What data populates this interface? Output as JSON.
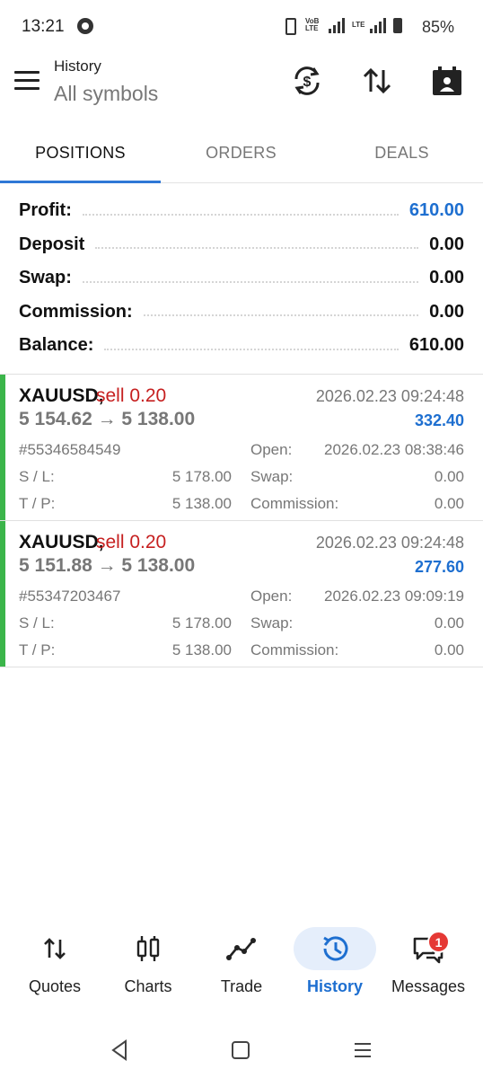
{
  "status_bar": {
    "time": "13:21",
    "battery": "85%",
    "net_label": "VoB LTE",
    "lte_label": "LTE"
  },
  "header": {
    "title": "History",
    "subtitle": "All symbols",
    "icons": [
      "menu-icon",
      "currency-exchange-icon",
      "sort-icon",
      "calendar-icon"
    ]
  },
  "tabs": [
    {
      "label": "POSITIONS",
      "active": true
    },
    {
      "label": "ORDERS",
      "active": false
    },
    {
      "label": "DEALS",
      "active": false
    }
  ],
  "summary": [
    {
      "label": "Profit:",
      "value": "610.00",
      "highlight": true
    },
    {
      "label": "Deposit",
      "value": "0.00",
      "highlight": false
    },
    {
      "label": "Swap:",
      "value": "0.00",
      "highlight": false
    },
    {
      "label": "Commission:",
      "value": "0.00",
      "highlight": false
    },
    {
      "label": "Balance:",
      "value": "610.00",
      "highlight": false
    }
  ],
  "positions": [
    {
      "symbol": "XAUUSD,",
      "side": "sell 0.20",
      "prices": "5 154.62 → 5 138.00",
      "close_time": "2026.02.23 09:24:48",
      "profit": "332.40",
      "ticket": "#55346584549",
      "sl_label": "S / L:",
      "sl_value": "5 178.00",
      "tp_label": "T / P:",
      "tp_value": "5 138.00",
      "open_label": "Open:",
      "open_value": "2026.02.23 08:38:46",
      "swap_label": "Swap:",
      "swap_value": "0.00",
      "commission_label": "Commission:",
      "commission_value": "0.00"
    },
    {
      "symbol": "XAUUSD,",
      "side": "sell 0.20",
      "prices": "5 151.88 → 5 138.00",
      "close_time": "2026.02.23 09:24:48",
      "profit": "277.60",
      "ticket": "#55347203467",
      "sl_label": "S / L:",
      "sl_value": "5 178.00",
      "tp_label": "T / P:",
      "tp_value": "5 138.00",
      "open_label": "Open:",
      "open_value": "2026.02.23 09:09:19",
      "swap_label": "Swap:",
      "swap_value": "0.00",
      "commission_label": "Commission:",
      "commission_value": "0.00"
    }
  ],
  "bottom_nav": [
    {
      "label": "Quotes",
      "icon": "quotes-icon",
      "active": false
    },
    {
      "label": "Charts",
      "icon": "charts-icon",
      "active": false
    },
    {
      "label": "Trade",
      "icon": "trade-icon",
      "active": false
    },
    {
      "label": "History",
      "icon": "history-icon",
      "active": true
    },
    {
      "label": "Messages",
      "icon": "messages-icon",
      "active": false
    }
  ],
  "messages_badge": "1",
  "colors": {
    "accent": "#1e6fd0",
    "sell": "#c62020",
    "position_bar": "#3bb54a",
    "badge": "#e53935"
  }
}
